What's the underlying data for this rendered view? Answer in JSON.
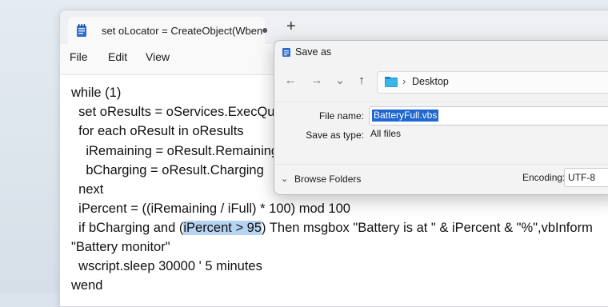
{
  "notepad": {
    "tab_title": "set oLocator = CreateObject(Wben",
    "tab_modified_dot": "●",
    "new_tab": "+",
    "menu": [
      "File",
      "Edit",
      "View"
    ],
    "code": {
      "l1": "while (1)",
      "l2": "  set oResults = oServices.ExecQu",
      "l3": "  for each oResult in oResults",
      "l4": "    iRemaining = oResult.Remaining",
      "l5": "    bCharging = oResult.Charging",
      "l6": "  next",
      "l7": "  iPercent = ((iRemaining / iFull) * 100) mod 100",
      "l8_pre": "  if bCharging and (",
      "l8_sel": "iPercent > 95",
      "l8_post": ") Then msgbox \"Battery is at \" & iPercent & \"%\",vbInform",
      "l9": "\"Battery monitor\"",
      "l10": "  wscript.sleep 30000 ' 5 minutes",
      "l11": "wend"
    }
  },
  "dialog": {
    "title": "Save as",
    "nav": {
      "back": "←",
      "forward": "→",
      "dropdown": "⌄",
      "up": "↑"
    },
    "address": {
      "separator": "›",
      "location": "Desktop"
    },
    "file_name_label": "File name:",
    "file_name_value": "BatteryFull.vbs",
    "save_type_label": "Save as type:",
    "save_type_value": "All files",
    "browse_chevron": "⌄",
    "browse_label": "Browse Folders",
    "encoding_label": "Encoding:",
    "encoding_value": "UTF-8"
  },
  "icons": [
    "notepad-icon",
    "folder-icon",
    "back-arrow-icon",
    "forward-arrow-icon",
    "chevron-down-icon",
    "up-arrow-icon"
  ],
  "colors": {
    "selection": "#1e66d0",
    "text_selection": "#b7d3f2",
    "dialog_bg": "#f3f3f3"
  }
}
